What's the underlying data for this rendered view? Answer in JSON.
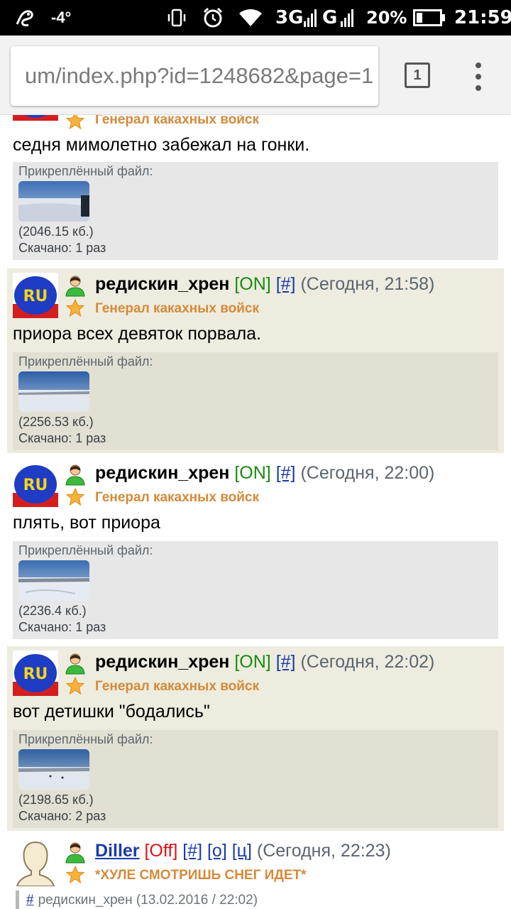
{
  "status_bar": {
    "temperature": "-4°",
    "network": "3G",
    "signal_g": "G",
    "battery": "20%",
    "time": "21:59"
  },
  "browser": {
    "url": "um/index.php?id=1248682&page=1",
    "tab_count": "1"
  },
  "posts": [
    {
      "rank": "Генерал какахных войск",
      "message": "седня мимолетно забежал на гонки.",
      "attachment": {
        "label": "Прикреплённый файл:",
        "size": "(2046.15 кб.)",
        "downloads": "Скачано: 1 раз"
      }
    },
    {
      "nick": "редискин_хрен",
      "status": "[ON]",
      "hash": "[#]",
      "time": "(Сегодня, 21:58)",
      "rank": "Генерал какахных войск",
      "message": "приора всех девяток порвала.",
      "attachment": {
        "label": "Прикреплённый файл:",
        "size": "(2256.53 кб.)",
        "downloads": "Скачано: 1 раз"
      }
    },
    {
      "nick": "редискин_хрен",
      "status": "[ON]",
      "hash": "[#]",
      "time": "(Сегодня, 22:00)",
      "rank": "Генерал какахных войск",
      "message": "плять, вот приора",
      "attachment": {
        "label": "Прикреплённый файл:",
        "size": "(2236.4 кб.)",
        "downloads": "Скачано: 1 раз"
      }
    },
    {
      "nick": "редискин_хрен",
      "status": "[ON]",
      "hash": "[#]",
      "time": "(Сегодня, 22:02)",
      "rank": "Генерал какахных войск",
      "message": "вот детишки \"бодались\"",
      "attachment": {
        "label": "Прикреплённый файл:",
        "size": "(2198.65 кб.)",
        "downloads": "Скачано: 2 раз"
      }
    },
    {
      "nick": "Diller",
      "status": "[Off]",
      "hash": "[#]",
      "reply": "[о]",
      "quote_link": "[ц]",
      "time": "(Сегодня, 22:23)",
      "rank": "*ХУЛЕ СМОТРИШЬ СНЕГ ИДЕТ*",
      "quote": {
        "hash": "#",
        "text": "редискин_хрен (13.02.2016 / 22:02)"
      }
    }
  ],
  "colors": {
    "online": "#1a8a12",
    "offline": "#e01010",
    "link": "#1a3aa8",
    "rank": "#d58a3a",
    "alt_row": "#edecdf"
  }
}
